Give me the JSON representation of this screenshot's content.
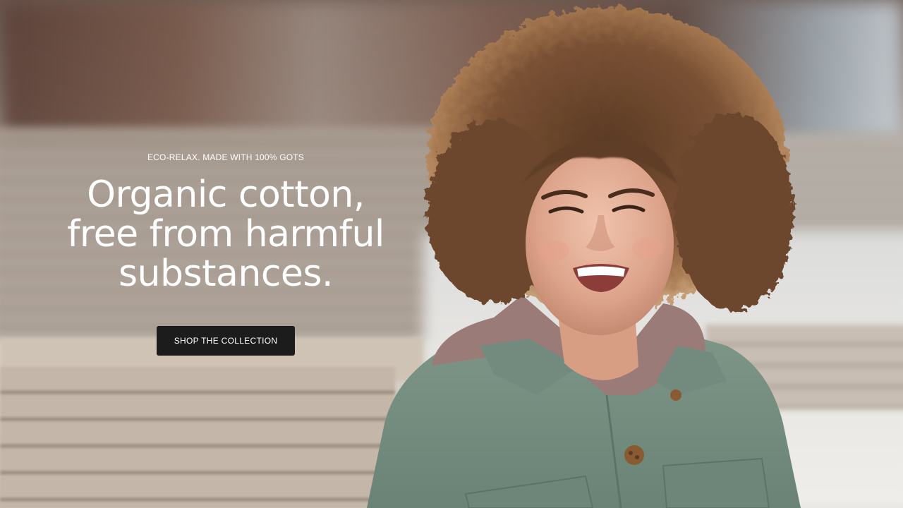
{
  "hero": {
    "eyebrow": "ECO-RELAX. MADE WITH 100% GOTS",
    "headline_lines": [
      "Organic cotton,",
      "free from harmful",
      "substances."
    ],
    "cta_label": "SHOP THE COLLECTION",
    "image_alt": "Smiling woman with curly hair wearing a green wool jacket and mauve hoodie outdoors in snow"
  },
  "colors": {
    "text": "#ffffff",
    "button_bg": "#1c1c1c",
    "button_text": "#ffffff"
  }
}
